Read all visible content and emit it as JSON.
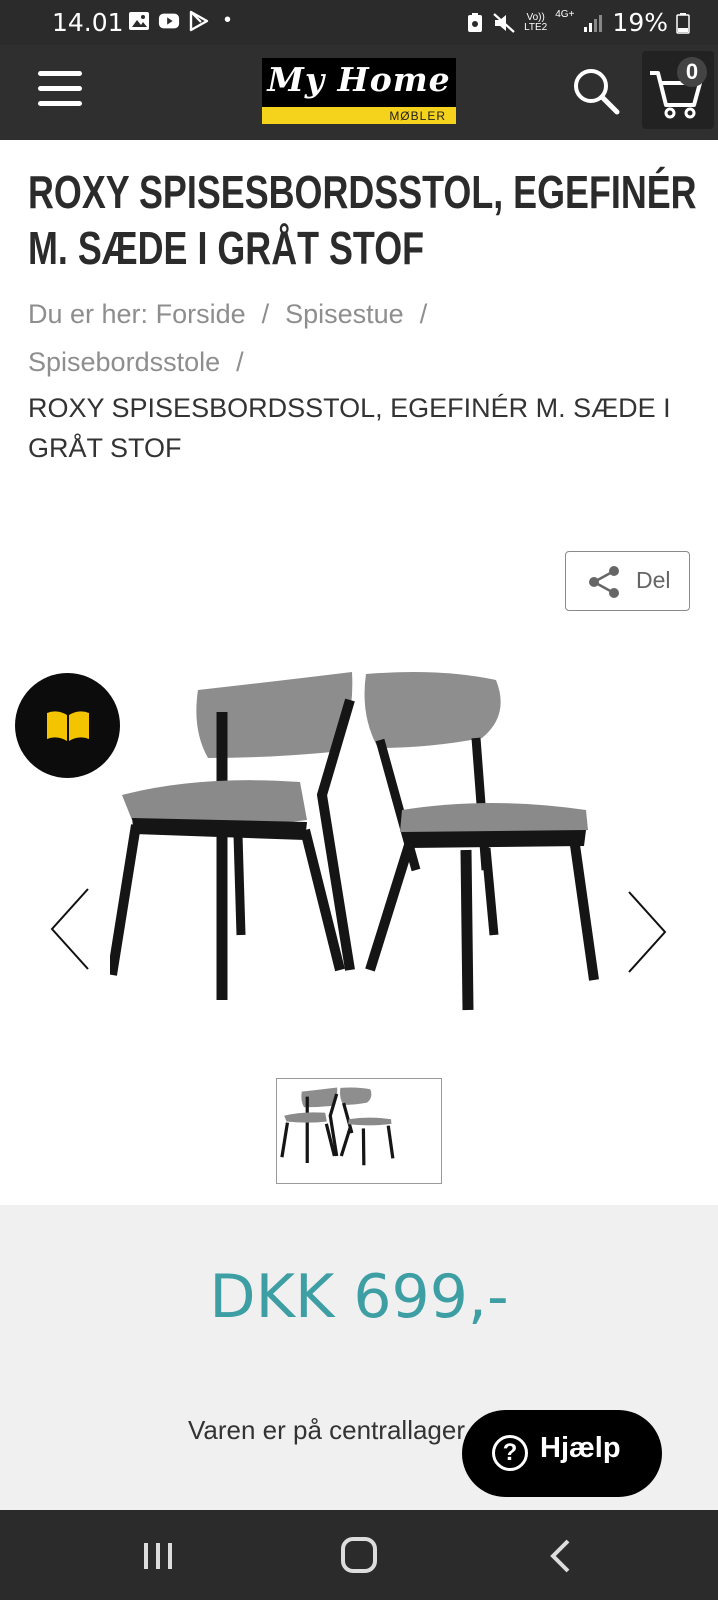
{
  "status_bar": {
    "time": "14.01",
    "dot": "•",
    "network_top": "Vo))",
    "network_bottom": "LTE2",
    "signal_label": "4G+",
    "battery": "19%"
  },
  "header": {
    "logo_text": "My Home",
    "logo_sub": "MØBLER",
    "cart_count": "0"
  },
  "product": {
    "title": "ROXY SPISESBORDSSTOL, EGEFINÉR M. SÆDE I GRÅT STOF",
    "share_label": "Del",
    "price": "DKK 699,-",
    "stock_text": "Varen er på centrallager"
  },
  "breadcrumb": {
    "prefix": "Du er her:",
    "items": [
      "Forside",
      "Spisestue",
      "Spisebordsstole"
    ],
    "separator": "/",
    "current": "ROXY SPISESBORDSSTOL, EGEFINÉR M. SÆDE I GRÅT STOF"
  },
  "help": {
    "icon": "?",
    "label": "Hjælp"
  },
  "colors": {
    "header_bg": "#2f2f2f",
    "logo_yellow": "#f5d21c",
    "price": "#3d9ea3",
    "price_bg": "#f0f0f0"
  },
  "icons": [
    "menu-icon",
    "search-icon",
    "cart-icon",
    "share-icon",
    "book-icon",
    "chevron-left-icon",
    "chevron-right-icon"
  ]
}
